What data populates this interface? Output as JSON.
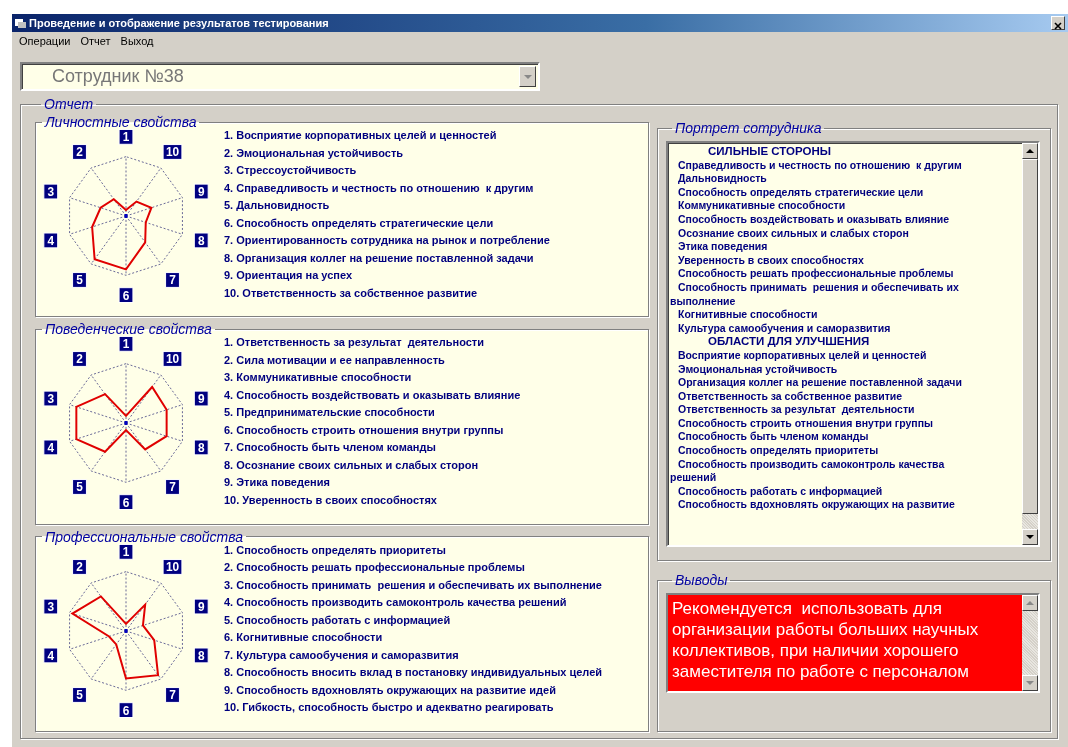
{
  "window": {
    "title": "Проведение и отображение результатов тестирования"
  },
  "menu": [
    "Операции",
    "Отчет",
    "Выход"
  ],
  "employee_select": {
    "value": "Сотрудник №38"
  },
  "report": {
    "title": "Отчет",
    "sections": [
      {
        "title": "Личностные свойства",
        "axis_labels": [
          "1",
          "2",
          "3",
          "4",
          "5",
          "6",
          "7",
          "8",
          "9",
          "10"
        ],
        "items": [
          "1. Восприятие корпоративных целей и ценностей",
          "2. Эмоциональная устойчивость",
          "3. Стрессоустойчивость",
          "4. Справедливость и честность по отношению  к другим",
          "5. Дальновидность",
          "6. Способность определять стратегические цели",
          "7. Ориентированность сотрудника на рынок и потребление",
          "8. Организация коллег на решение поставленной задачи",
          "9. Ориентация на успех",
          "10. Ответственность за собственное развитие"
        ]
      },
      {
        "title": "Поведенческие свойства",
        "axis_labels": [
          "1",
          "2",
          "3",
          "4",
          "5",
          "6",
          "7",
          "8",
          "9",
          "10"
        ],
        "items": [
          "1. Ответственность за результат  деятельности",
          "2. Сила мотивации и ее направленность",
          "3. Коммуникативные способности",
          "4. Способность воздействовать и оказывать влияние",
          "5. Предпринимательские способности",
          "6. Способность строить отношения внутри группы",
          "7. Способность быть членом команды",
          "8. Осознание своих сильных и слабых сторон",
          "9. Этика поведения",
          "10. Уверенность в своих способностях"
        ]
      },
      {
        "title": "Профессиональные свойства",
        "axis_labels": [
          "1",
          "2",
          "3",
          "4",
          "5",
          "6",
          "7",
          "8",
          "9",
          "10"
        ],
        "items": [
          "1. Способность определять приоритеты",
          "2. Способность решать профессиональные проблемы",
          "3. Способность принимать  решения и обеспечивать их выполнение",
          "4. Способность производить самоконтроль качества решений",
          "5. Способность работать с информацией",
          "6. Когнитивные способности",
          "7. Культура самообучения и саморазвития",
          "8. Способность вносить вклад в постановку индивидуальных целей",
          "9. Способность вдохновлять окружающих на развитие идей",
          "10. Гибкость, способность быстро и адекватно реагировать"
        ]
      }
    ]
  },
  "portrait": {
    "title": "Портрет сотрудника",
    "lines": [
      {
        "kind": "heading",
        "text": "СИЛЬНЫЕ СТОРОНЫ"
      },
      {
        "kind": "item",
        "text": "Справедливость и честность по отношению  к другим"
      },
      {
        "kind": "item",
        "text": "Дальновидность"
      },
      {
        "kind": "item",
        "text": "Способность определять стратегические цели"
      },
      {
        "kind": "item",
        "text": "Коммуникативные способности"
      },
      {
        "kind": "item",
        "text": "Способность воздействовать и оказывать влияние"
      },
      {
        "kind": "item",
        "text": "Осознание своих сильных и слабых сторон"
      },
      {
        "kind": "item",
        "text": "Этика поведения"
      },
      {
        "kind": "item",
        "text": "Уверенность в своих способностях"
      },
      {
        "kind": "item",
        "text": "Способность решать профессиональные проблемы"
      },
      {
        "kind": "item",
        "text": "Способность принимать  решения и обеспечивать их выполнение"
      },
      {
        "kind": "item",
        "text": "Когнитивные способности"
      },
      {
        "kind": "item",
        "text": "Культура самообучения и саморазвития"
      },
      {
        "kind": "heading",
        "text": "ОБЛАСТИ ДЛЯ УЛУЧШЕНИЯ"
      },
      {
        "kind": "item",
        "text": "Восприятие корпоративных целей и ценностей"
      },
      {
        "kind": "item",
        "text": "Эмоциональная устойчивость"
      },
      {
        "kind": "item",
        "text": "Организация коллег на решение поставленной задачи"
      },
      {
        "kind": "item",
        "text": "Ответственность за собственное развитие"
      },
      {
        "kind": "item",
        "text": "Ответственность за результат  деятельности"
      },
      {
        "kind": "item",
        "text": "Способность строить отношения внутри группы"
      },
      {
        "kind": "item",
        "text": "Способность быть членом команды"
      },
      {
        "kind": "item",
        "text": "Способность определять приоритеты"
      },
      {
        "kind": "item",
        "text": "Способность производить самоконтроль качества решений"
      },
      {
        "kind": "item",
        "text": "Способность работать с информацией"
      },
      {
        "kind": "item",
        "text": "Способность вдохновлять окружающих на развитие"
      }
    ]
  },
  "conclusions": {
    "title": "Выводы",
    "text": "Рекомендуется  использовать для организации работы больших научных коллективов, при наличии хорошего заместителя по работе с персоналом"
  }
}
